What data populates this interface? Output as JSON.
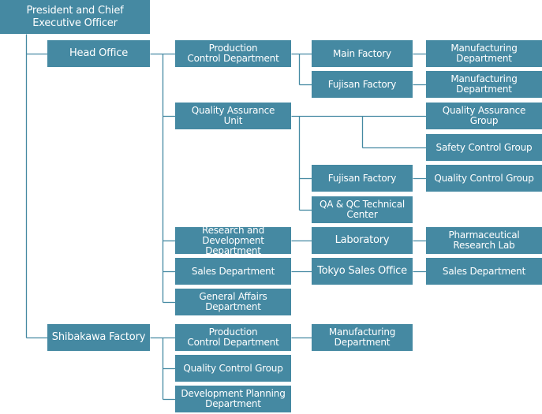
{
  "colors": {
    "box": "#4589a2",
    "line": "#4589a2",
    "text": "#ffffff"
  },
  "nodes": [
    {
      "id": "ceo",
      "label": "President and Chief\nExecutive Officer"
    },
    {
      "id": "head",
      "label": "Head Office"
    },
    {
      "id": "prod",
      "label": "Production\nControl Department"
    },
    {
      "id": "qau",
      "label": "Quality Assurance\nUnit"
    },
    {
      "id": "rnd",
      "label": "Research and\nDevelopment Department"
    },
    {
      "id": "sales",
      "label": "Sales Department"
    },
    {
      "id": "ga",
      "label": "General Affairs\nDepartment"
    },
    {
      "id": "main",
      "label": "Main Factory"
    },
    {
      "id": "fuji1",
      "label": "Fujisan Factory"
    },
    {
      "id": "manuf1",
      "label": "Manufacturing\nDepartment"
    },
    {
      "id": "manuf2",
      "label": "Manufacturing\nDepartment"
    },
    {
      "id": "qag",
      "label": "Quality Assurance Group"
    },
    {
      "id": "scg",
      "label": "Safety Control Group"
    },
    {
      "id": "fuji2",
      "label": "Fujisan Factory"
    },
    {
      "id": "qcg1",
      "label": "Quality Control Group"
    },
    {
      "id": "qaqc",
      "label": "QA & QC Technical\nCenter"
    },
    {
      "id": "lab",
      "label": "Laboratory"
    },
    {
      "id": "pharma",
      "label": "Pharmaceutical\nResearch Lab"
    },
    {
      "id": "tokyo",
      "label": "Tokyo Sales Office"
    },
    {
      "id": "sales2",
      "label": "Sales Department"
    },
    {
      "id": "shiba",
      "label": "Shibakawa Factory"
    },
    {
      "id": "sprod",
      "label": "Production\nControl Department"
    },
    {
      "id": "smanuf",
      "label": "Manufacturing\nDepartment"
    },
    {
      "id": "sqcg",
      "label": "Quality Control Group"
    },
    {
      "id": "sdev",
      "label": "Development Planning\nDepartment"
    }
  ]
}
